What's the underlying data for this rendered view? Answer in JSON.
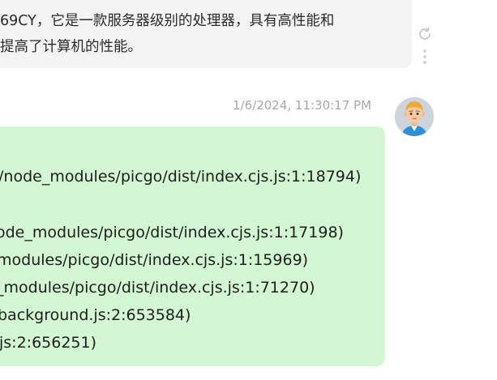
{
  "assistant_message": {
    "line1": "69CY，它是一款服务器级别的处理器，具有高性能和",
    "line2": "提高了计算机的性能。"
  },
  "actions": {
    "regenerate_icon": "refresh-icon",
    "more_icon": "vertical-dots-icon"
  },
  "user_message": {
    "timestamp": "1/6/2024, 11:30:17 PM",
    "lines": [
      "/node_modules/picgo/dist/index.cjs.js:1:18794)",
      "ode_modules/picgo/dist/index.cjs.js:1:17198)",
      "modules/picgo/dist/index.cjs.js:1:15969)",
      "_modules/picgo/dist/index.cjs.js:1:71270)",
      "background.js:2:653584)",
      "js:2:656251)"
    ]
  },
  "colors": {
    "assistant_bubble": "#f4f4f5",
    "user_bubble": "#d2f7d2",
    "timestamp": "#a8a8ac"
  }
}
